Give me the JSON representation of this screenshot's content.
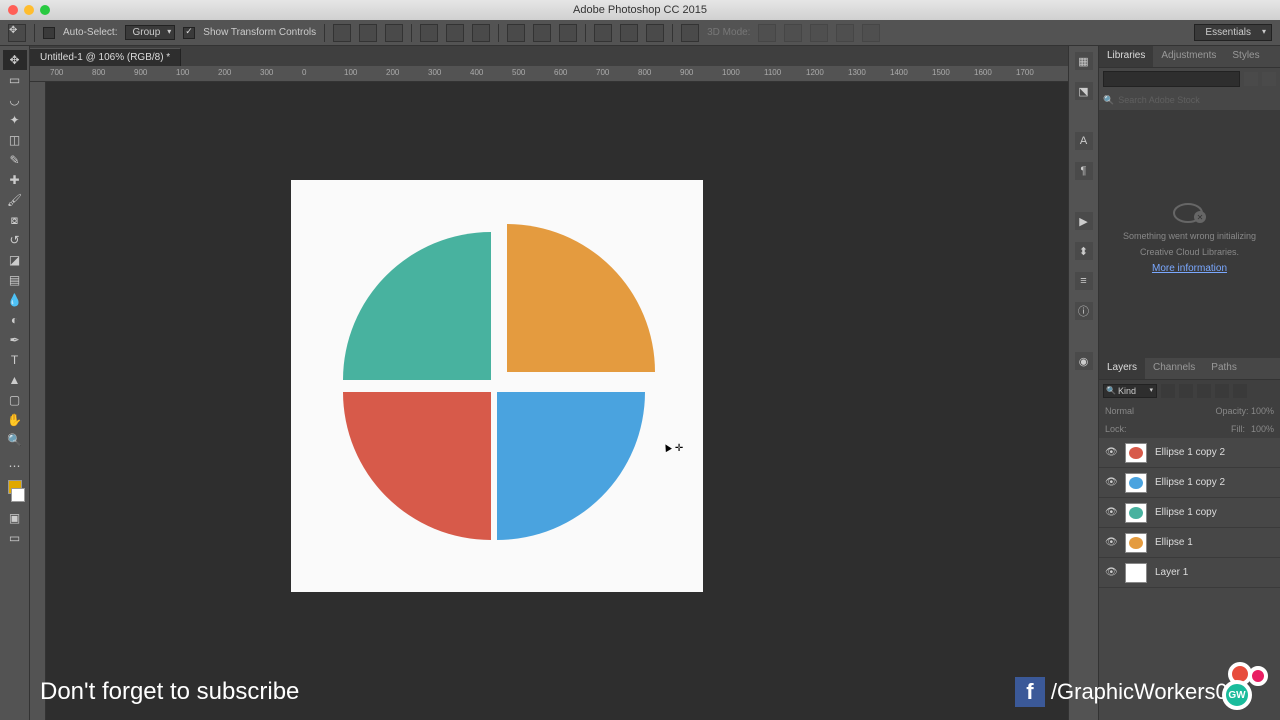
{
  "app": {
    "title": "Adobe Photoshop CC 2015"
  },
  "options": {
    "auto_select": "Auto-Select:",
    "group": "Group",
    "show_transform": "Show Transform Controls",
    "mode3d": "3D Mode:",
    "workspace": "Essentials"
  },
  "document": {
    "tab": "Untitled-1 @ 106% (RGB/8) *"
  },
  "ruler_ticks": [
    "700",
    "800",
    "900",
    "100",
    "200",
    "300",
    "0",
    "100",
    "200",
    "300",
    "400",
    "500",
    "600",
    "700",
    "800",
    "900",
    "1000",
    "1100",
    "1200",
    "1300",
    "1400",
    "1500",
    "1600",
    "1700"
  ],
  "right_tabs": {
    "libraries": "Libraries",
    "adjustments": "Adjustments",
    "styles": "Styles"
  },
  "libraries": {
    "search_placeholder": "Search Adobe Stock",
    "error1": "Something went wrong initializing",
    "error2": "Creative Cloud Libraries.",
    "more": "More information"
  },
  "layers_tabs": {
    "layers": "Layers",
    "channels": "Channels",
    "paths": "Paths"
  },
  "layers_ctrl": {
    "kind": "Kind",
    "normal": "Normal",
    "opacity": "Opacity:",
    "opv": "100%",
    "lock": "Lock:",
    "fill": "Fill:",
    "fillv": "100%"
  },
  "layers": [
    {
      "name": "Ellipse 1 copy 2",
      "color": "#d75a4a"
    },
    {
      "name": "Ellipse 1 copy 2",
      "color": "#4aa3df"
    },
    {
      "name": "Ellipse 1 copy",
      "color": "#48b29f"
    },
    {
      "name": "Ellipse 1",
      "color": "#e49b3f"
    },
    {
      "name": "Layer 1",
      "color": "#ffffff"
    }
  ],
  "overlay": {
    "subscribe": "Don't forget to subscribe",
    "handle": "/GraphicWorkers01"
  },
  "chart_data": {
    "type": "pie",
    "title": "",
    "series": [
      {
        "name": "Teal",
        "value": 25,
        "color": "#48b29f",
        "offset_x": -6,
        "offset_y": -6
      },
      {
        "name": "Orange",
        "value": 25,
        "color": "#e49b3f",
        "offset_x": 10,
        "offset_y": -14
      },
      {
        "name": "Blue",
        "value": 25,
        "color": "#4aa3df",
        "offset_x": 0,
        "offset_y": 6
      },
      {
        "name": "Red",
        "value": 25,
        "color": "#d75a4a",
        "offset_x": -6,
        "offset_y": 6
      }
    ]
  }
}
